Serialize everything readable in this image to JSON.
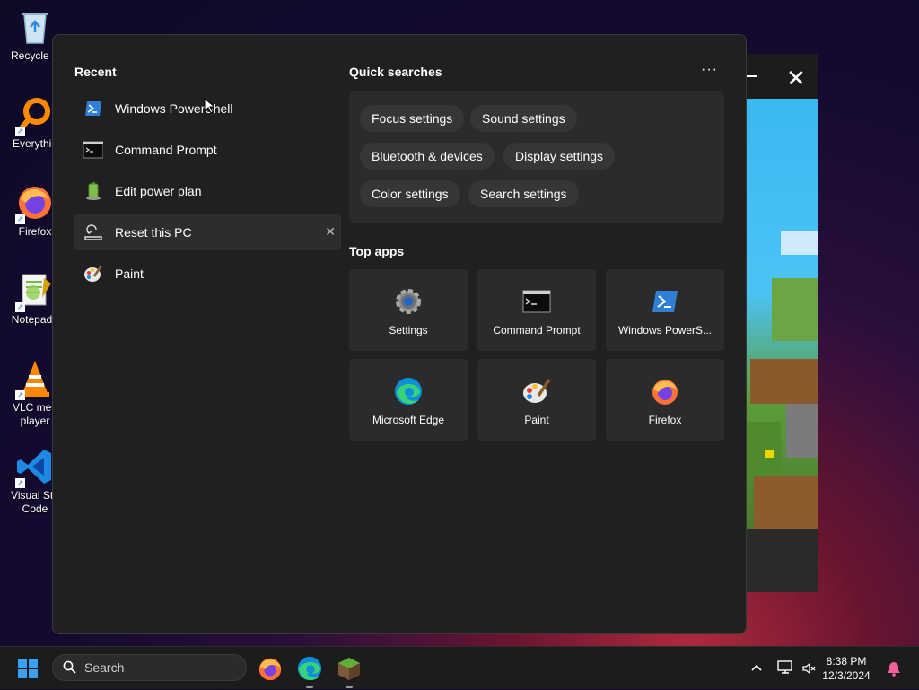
{
  "desktop": {
    "icons": [
      {
        "label": "Recycle B",
        "icon": "recycle-bin-icon"
      },
      {
        "label": "Everythin",
        "icon": "everything-search-icon"
      },
      {
        "label": "Firefox",
        "icon": "firefox-icon"
      },
      {
        "label": "Notepad+",
        "icon": "notepad-plus-plus-icon"
      },
      {
        "label": "VLC med",
        "label2": "player",
        "icon": "vlc-icon"
      },
      {
        "label": "Visual Stu",
        "label2": "Code",
        "icon": "vscode-icon"
      }
    ]
  },
  "search_flyout": {
    "recent": {
      "title": "Recent",
      "items": [
        {
          "label": "Windows PowerShell",
          "icon": "powershell-icon"
        },
        {
          "label": "Command Prompt",
          "icon": "command-prompt-icon"
        },
        {
          "label": "Edit power plan",
          "icon": "battery-icon"
        },
        {
          "label": "Reset this PC",
          "icon": "reset-pc-icon",
          "remove": "✕"
        },
        {
          "label": "Paint",
          "icon": "paint-icon"
        }
      ]
    },
    "quick_searches": {
      "title": "Quick searches",
      "more": "···",
      "chips": [
        "Focus settings",
        "Sound settings",
        "Bluetooth & devices",
        "Display settings",
        "Color settings",
        "Search settings"
      ]
    },
    "top_apps": {
      "title": "Top apps",
      "apps": [
        {
          "label": "Settings",
          "icon": "settings-gear-icon"
        },
        {
          "label": "Command Prompt",
          "icon": "command-prompt-icon"
        },
        {
          "label": "Windows PowerS...",
          "icon": "powershell-icon"
        },
        {
          "label": "Microsoft Edge",
          "icon": "edge-icon"
        },
        {
          "label": "Paint",
          "icon": "paint-icon"
        },
        {
          "label": "Firefox",
          "icon": "firefox-icon"
        }
      ]
    }
  },
  "background_window": {
    "minimize": "minimize-icon",
    "close": "✕"
  },
  "taskbar": {
    "search_placeholder": "Search",
    "pinned": [
      "firefox-icon",
      "edge-icon",
      "minecraft-icon"
    ],
    "clock": {
      "time": "8:38 PM",
      "date": "12/3/2024"
    },
    "tray_icons": [
      "chevron-up-icon",
      "network-icon",
      "volume-muted-icon",
      "notification-bell-icon"
    ]
  },
  "colors": {
    "flyout_bg": "#202020",
    "panel_bg": "#2b2b2b",
    "chip_bg": "#363636",
    "accent_blue": "#0a64d6"
  }
}
